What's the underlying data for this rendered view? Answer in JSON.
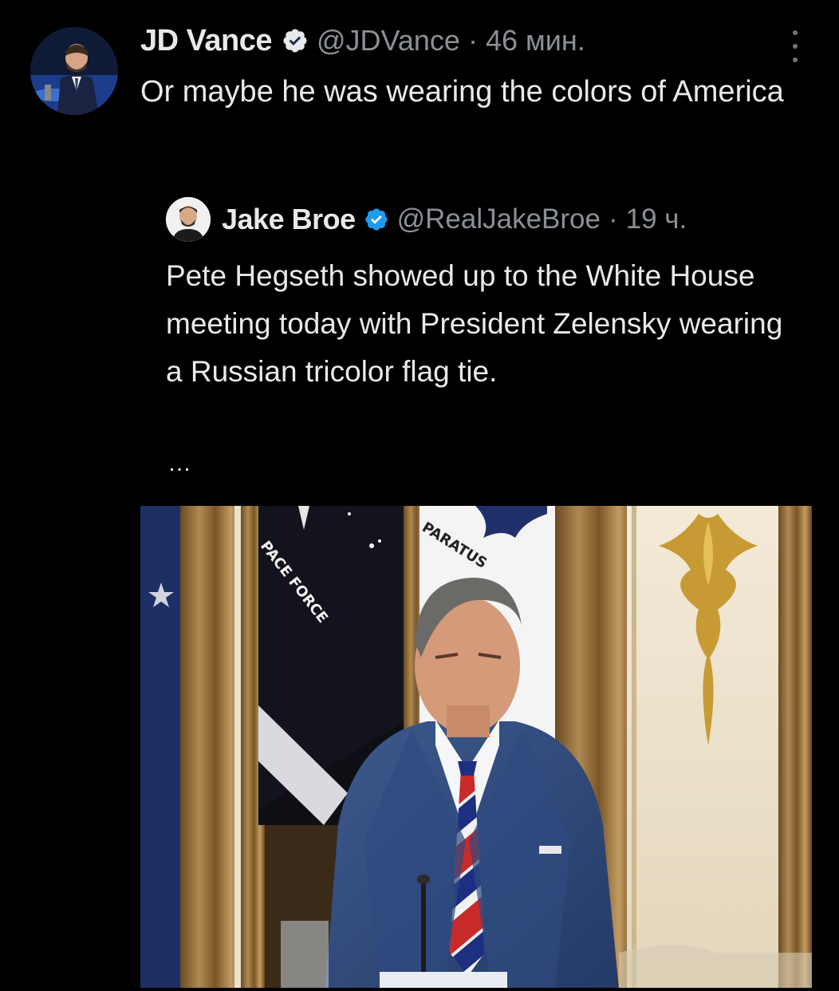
{
  "post": {
    "author_name": "JD Vance",
    "handle": "@JDVance",
    "separator": "·",
    "time": "46 мин.",
    "text": "Or maybe he was wearing the colors of America",
    "avatar_icon": "profile-photo",
    "verified_icon": "verified-badge-icon",
    "more_icon": "more-options-icon"
  },
  "quote": {
    "author_name": "Jake Broe",
    "handle": "@RealJakeBroe",
    "separator": "·",
    "time": "19 ч.",
    "text": "Pete Hegseth showed up to the White House meeting today with President Zelensky wearing a Russian tricolor flag tie.",
    "ellipsis": "…",
    "media": {
      "flag_left_text": "PACE FORCE",
      "flag_right_text": "PARATUS"
    }
  },
  "colors": {
    "background": "#000000",
    "text": "#e7e9ea",
    "secondary_text": "#8b9096",
    "verified_blue": "#1d9bf0"
  }
}
